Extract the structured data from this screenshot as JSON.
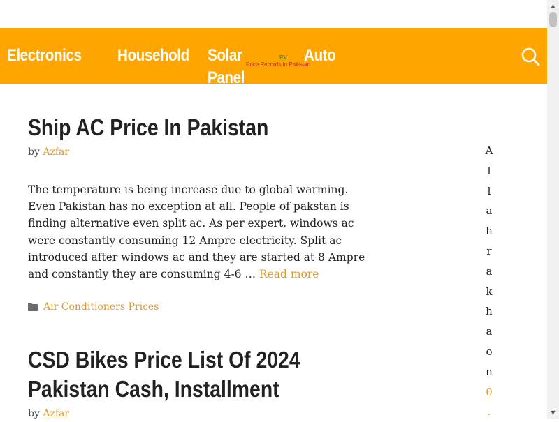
{
  "nav": {
    "items": [
      {
        "label": "Electronics"
      },
      {
        "label": "Household"
      },
      {
        "label": "Solar Panel"
      },
      {
        "label": "Auto"
      }
    ]
  },
  "logo": {
    "mark": "RV",
    "tagline": "Price Records In Pakistan"
  },
  "search": {
    "icon": "search-icon"
  },
  "posts": [
    {
      "title": "Ship AC Price In Pakistan",
      "by": "by",
      "author": "Azfar",
      "excerpt": "The temperature is being increase due to global warming. Even Pakistan has no exception at all. People of pakstan is finding alternative even split ac. As per expert, windows ac were constantly consuming 12 Ampre electricity. Split ac introduced after windows ac and they are started at 8 Ampre and constantly they are consuming 4-6 …",
      "read_more": "Read more",
      "category": "Air Conditioners Prices",
      "category_icon": "folder-icon"
    },
    {
      "title_line1": "CSD Bikes Price List Of 2024",
      "title_line2": "Pakistan Cash, Installment",
      "by": "by",
      "author": "Azfar"
    }
  ],
  "sidebar": {
    "letters": [
      "A",
      "l",
      "l",
      "a",
      "h",
      "r",
      "a",
      "k",
      "h",
      "a",
      "o",
      "n"
    ],
    "link_char": "0",
    "tail_char": "."
  },
  "colors": {
    "header": "#ffa500",
    "link": "#e09a22",
    "text": "#222222"
  }
}
